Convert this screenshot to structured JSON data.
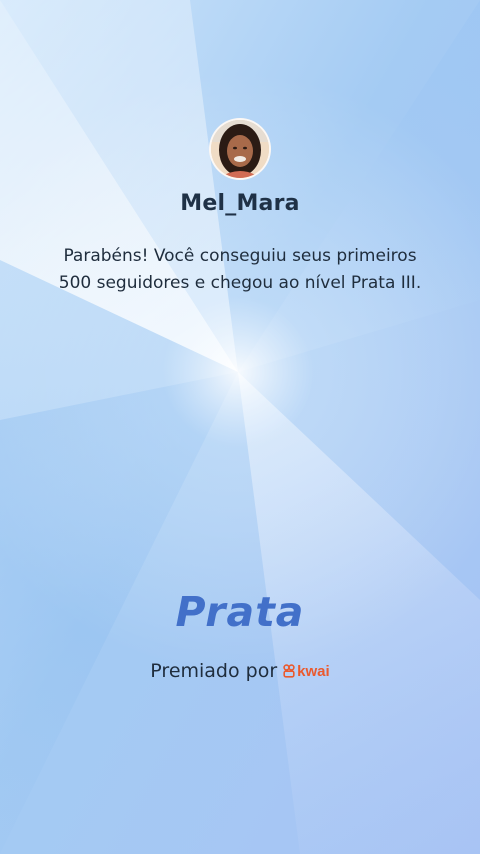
{
  "profile": {
    "username": "Mel_Mara",
    "avatar_icon": "user-avatar-photo"
  },
  "message": {
    "line1": "Parabéns! Você conseguiu seus primeiros",
    "line2": "500 seguidores e chegou ao nível Prata III."
  },
  "tier": {
    "label": "Prata"
  },
  "awarded": {
    "text": "Premiado por",
    "brand": "kwai",
    "brand_icon": "kwai-logo-icon"
  },
  "colors": {
    "tier": "#4270c9",
    "brand": "#ea5a2e",
    "text": "#1f2d3d",
    "background": "#a9cbf5"
  }
}
